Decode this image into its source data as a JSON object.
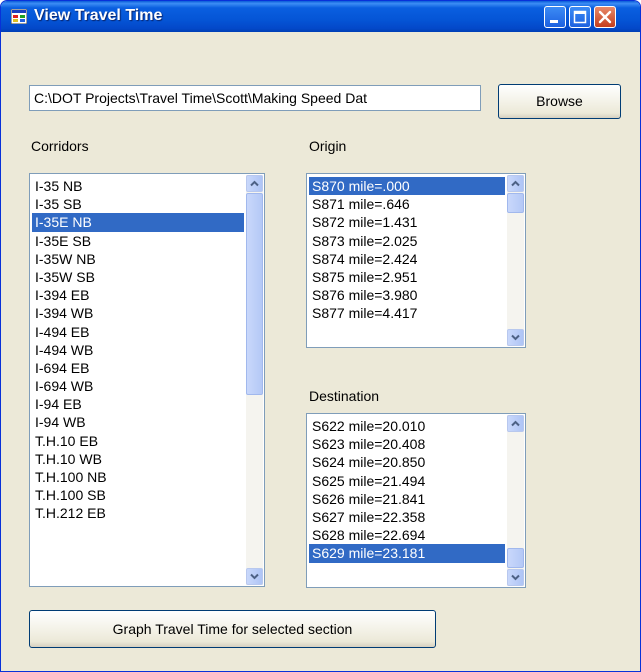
{
  "window": {
    "title": "View Travel Time"
  },
  "path_field": {
    "value": "C:\\DOT Projects\\Travel Time\\Scott\\Making Speed Dat"
  },
  "buttons": {
    "browse": "Browse",
    "graph": "Graph Travel Time for selected section"
  },
  "corridors": {
    "label": "Corridors",
    "items": [
      "I-35  NB",
      "I-35  SB",
      "I-35E  NB",
      "I-35E  SB",
      "I-35W  NB",
      "I-35W  SB",
      "I-394  EB",
      "I-394  WB",
      "I-494  EB",
      "I-494  WB",
      "I-694  EB",
      "I-694  WB",
      "I-94  EB",
      "I-94  WB",
      "T.H.10  EB",
      "T.H.10  WB",
      "T.H.100  NB",
      "T.H.100  SB",
      "T.H.212  EB"
    ],
    "selected_index": 2,
    "scroll_position": 0.0
  },
  "origin": {
    "label": "Origin",
    "items": [
      "S870  mile=.000",
      "S871  mile=.646",
      "S872  mile=1.431",
      "S873  mile=2.025",
      "S874  mile=2.424",
      "S875  mile=2.951",
      "S876  mile=3.980",
      "S877  mile=4.417"
    ],
    "selected_index": 0,
    "scroll_position": 0.0
  },
  "destination": {
    "label": "Destination",
    "items": [
      "S622  mile=20.010",
      "S623  mile=20.408",
      "S624  mile=20.850",
      "S625  mile=21.494",
      "S626  mile=21.841",
      "S627  mile=22.358",
      "S628  mile=22.694",
      "S629  mile=23.181"
    ],
    "selected_index": 7,
    "scroll_position": 1.0
  },
  "colors": {
    "selection": "#316ac5",
    "titlebar": "#0a5fe0",
    "window_face": "#ece9d8"
  }
}
